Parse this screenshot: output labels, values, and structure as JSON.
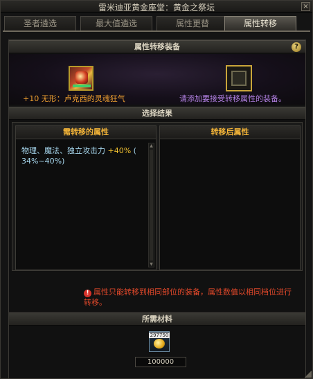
{
  "window": {
    "title": "雷米迪亚黄金座堂：黄金之祭坛",
    "close_label": "×"
  },
  "tabs": [
    {
      "label": "圣者遴选",
      "active": false
    },
    {
      "label": "最大值遴选",
      "active": false
    },
    {
      "label": "属性更替",
      "active": false
    },
    {
      "label": "属性转移",
      "active": true
    }
  ],
  "equip_section": {
    "header": "属性转移装备",
    "help_label": "?",
    "source_item_name": "+10 无形：卢克西的灵魂狂气",
    "target_hint": "请添加要接受转移属性的装备。"
  },
  "result_section": {
    "header": "选择结果",
    "left_column": {
      "title": "需转移的属性",
      "attr_text": "物理、魔法、独立攻击力",
      "attr_value": "+40%",
      "attr_range": "( 34%~40%)"
    },
    "right_column": {
      "title": "转移后属性"
    },
    "warning_icon": "!",
    "warning_text": "属性只能转移到相同部位的装备，属性数值以相同档位进行转移。"
  },
  "materials": {
    "header": "所需材料",
    "item_tag": "297750",
    "count": "100000"
  },
  "icons": {
    "close": "close-icon",
    "help": "help-icon",
    "warning": "warning-icon",
    "gold": "gold-coins-icon"
  },
  "colors": {
    "item_name": "#f0a030",
    "hint": "#b07fe0",
    "column_title": "#f3b438",
    "attr_text": "#a7d7ee",
    "warning": "#e0482a"
  }
}
